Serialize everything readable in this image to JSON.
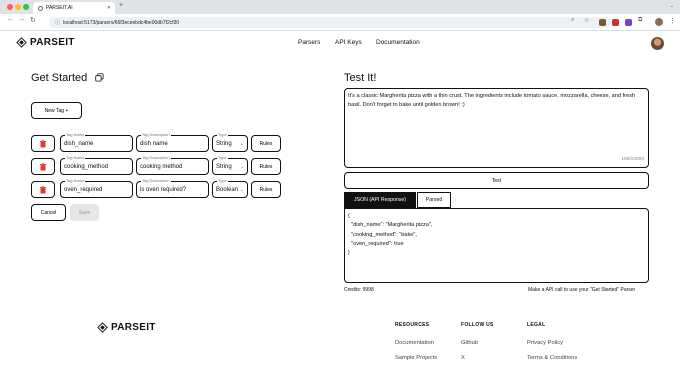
{
  "browser": {
    "tab_title": "PARSEIT.AI",
    "url": "localhost:5173/parsers/66f3eceebdc4be00db7f2cf30"
  },
  "header": {
    "logo_text": "PARSEIT",
    "nav": [
      "Parsers",
      "API Keys",
      "Documentation"
    ]
  },
  "get_started": {
    "title": "Get Started",
    "new_tag_label": "New Tag +",
    "labels": {
      "tag_name": "Tag Name",
      "tag_description": "Tag Description",
      "type": "Type",
      "rules": "Rules"
    },
    "tags": [
      {
        "name": "dish_name",
        "description": "dish name",
        "type": "String"
      },
      {
        "name": "cooking_method",
        "description": "cooking method",
        "type": "String"
      },
      {
        "name": "oven_required",
        "description": "is oven required?",
        "type": "Boolean"
      }
    ],
    "cancel_label": "Cancel",
    "save_label": "Save"
  },
  "test_it": {
    "title": "Test It!",
    "input_text": "It's a classic Margherita pizza with a thin crust. The ingredients include tomato sauce, mozzarella, cheese, and fresh basil. Don't forget to bake until golden brown! :)",
    "char_count": "169/10000",
    "test_label": "Test",
    "tabs": [
      "JSON (API Response)",
      "Parsed"
    ],
    "json_lines": [
      "{",
      "  \"dish_name\": \"Margherita pizza\",",
      "  \"cooking_method\": \"bake\",",
      "  \"oven_required\": true",
      "}"
    ],
    "credits": "Credits: 9998",
    "hint": "Make a API call to use your \"Get Started\" Parser"
  },
  "footer": {
    "logo_text": "PARSEIT",
    "columns": [
      {
        "heading": "RESOURCES",
        "links": [
          "Documentation",
          "Sample Projects"
        ]
      },
      {
        "heading": "FOLLOW US",
        "links": [
          "Github",
          "X"
        ]
      },
      {
        "heading": "LEGAL",
        "links": [
          "Privacy Policy",
          "Terms & Conditions"
        ]
      }
    ]
  },
  "colors": {
    "accent": "#111111",
    "delete_icon": "#e53935",
    "disabled": "#e6e6e6"
  }
}
